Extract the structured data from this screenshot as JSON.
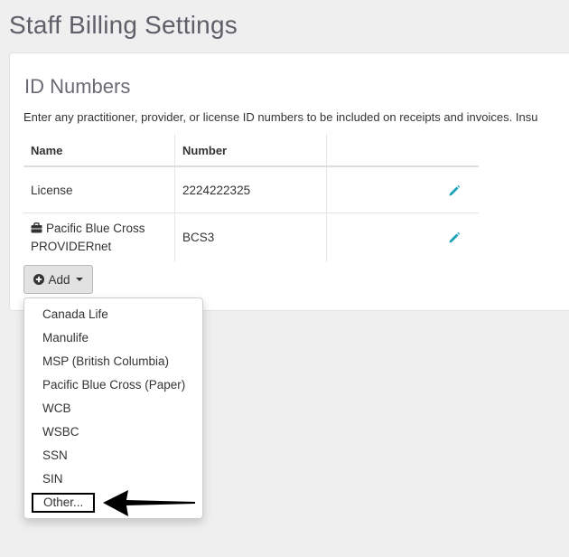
{
  "page": {
    "title": "Staff Billing Settings"
  },
  "id_numbers": {
    "title": "ID Numbers",
    "description": "Enter any practitioner, provider, or license ID numbers to be included on receipts and invoices. Insu",
    "columns": {
      "name": "Name",
      "number": "Number"
    },
    "rows": [
      {
        "name": "License",
        "number": "2224222325",
        "edit_icon": "pencil-icon"
      },
      {
        "name_line1": "Pacific Blue Cross",
        "name_line2": "PROVIDERnet",
        "number": "BCS3",
        "prefix_icon": "briefcase-icon",
        "edit_icon": "pencil-icon"
      }
    ]
  },
  "add_button": {
    "label": "Add",
    "icon": "plus-circle-icon",
    "caret": "caret-down-icon"
  },
  "dropdown": {
    "items": [
      "Canada Life",
      "Manulife",
      "MSP (British Columbia)",
      "Pacific Blue Cross (Paper)",
      "WCB",
      "WSBC",
      "SSN",
      "SIN",
      "Other..."
    ]
  },
  "colors": {
    "accent": "#1aa3b8",
    "page_bg": "#efefef",
    "highlight_border": "#000000"
  }
}
